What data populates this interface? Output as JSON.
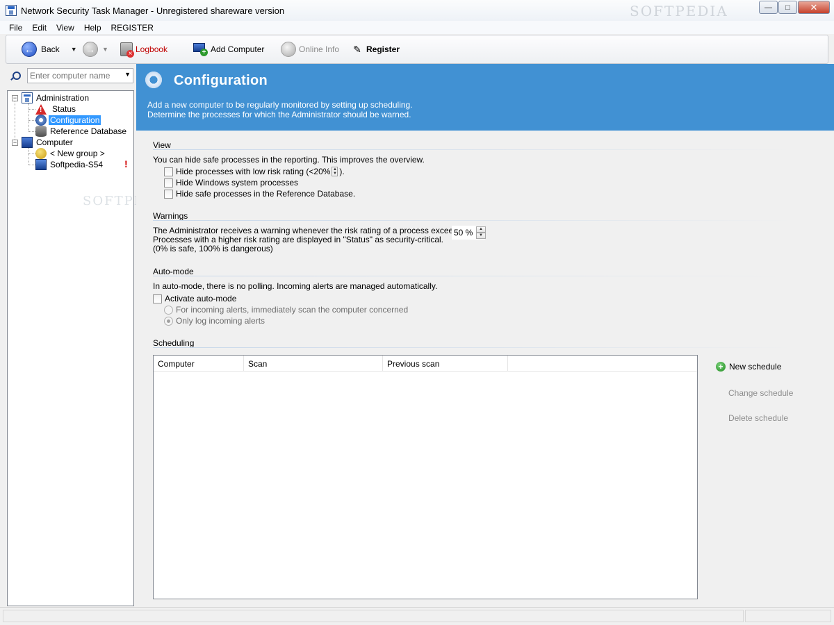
{
  "window": {
    "title": "Network Security Task Manager - Unregistered shareware version",
    "watermark": "SOFTPEDIA",
    "minimize": "—",
    "maximize": "□",
    "close": "✕"
  },
  "menu": [
    "File",
    "Edit",
    "View",
    "Help",
    "REGISTER"
  ],
  "toolbar": {
    "back": "Back",
    "logbook": "Logbook",
    "add_computer": "Add Computer",
    "online_info": "Online Info",
    "register": "Register",
    "logbook_color": "#c00000"
  },
  "search": {
    "placeholder": "Enter computer name"
  },
  "tree": {
    "administration": "Administration",
    "status": "Status",
    "configuration": "Configuration",
    "reference_database": "Reference Database",
    "computer": "Computer",
    "new_group": "< New group >",
    "host": "Softpedia-S54",
    "host_alert": "!"
  },
  "header": {
    "title": "Configuration",
    "line1": "Add a new computer to be regularly monitored by setting up scheduling.",
    "line2": "Determine the processes for which the Administrator should be warned.",
    "band_color": "#4191d3"
  },
  "view": {
    "title": "View",
    "intro": "You can hide safe processes in the reporting. This improves the overview.",
    "opt1_prefix": "Hide processes with low risk rating (<20%",
    "opt1_suffix": ").",
    "opt2": "Hide Windows system processes",
    "opt3": "Hide safe processes in the Reference Database."
  },
  "warnings": {
    "title": "Warnings",
    "line1": "The Administrator receives a warning whenever the risk rating of a process exceeds:",
    "line2": "Processes with a higher risk rating are displayed in \"Status\" as security-critical.",
    "line3": "(0% is  safe, 100% is dangerous)",
    "threshold": "50 %"
  },
  "automode": {
    "title": "Auto-mode",
    "intro": "In auto-mode, there is no polling. Incoming alerts are managed automatically.",
    "activate": "Activate auto-mode",
    "radio1": "For incoming alerts, immediately scan the computer concerned",
    "radio2": "Only log incoming alerts"
  },
  "scheduling": {
    "title": "Scheduling",
    "columns": [
      "Computer",
      "Scan",
      "Previous scan"
    ],
    "new_schedule": "New schedule",
    "change_schedule": "Change schedule",
    "delete_schedule": "Delete schedule"
  }
}
